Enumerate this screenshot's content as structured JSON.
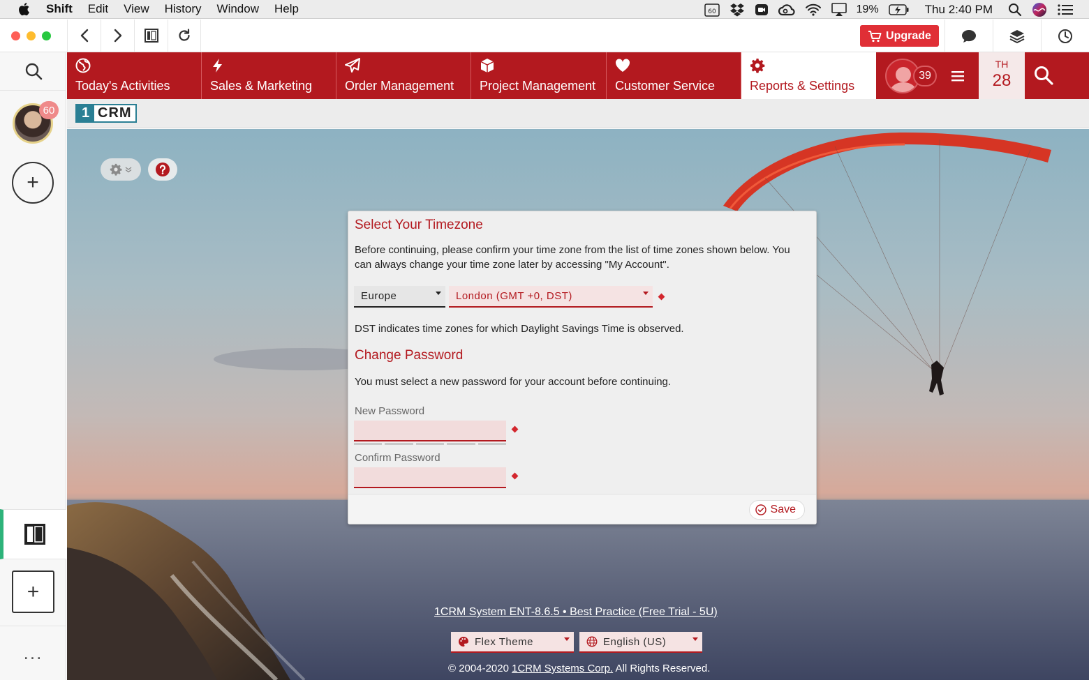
{
  "menubar": {
    "app_name": "Shift",
    "items": [
      "Edit",
      "View",
      "History",
      "Window",
      "Help"
    ],
    "battery": "19%",
    "clock": "Thu 2:40 PM",
    "icons": [
      "apple-logo",
      "cal60-icon",
      "dropbox-icon",
      "camera-icon",
      "creative-cloud-icon",
      "wifi-icon",
      "airplay-icon",
      "battery-icon",
      "spotlight-icon",
      "siri-icon",
      "notification-list-icon"
    ]
  },
  "toolbar": {
    "upgrade_label": "Upgrade",
    "icons": [
      "back-icon",
      "forward-icon",
      "app-icon",
      "reload-icon",
      "chat-icon",
      "layers-icon",
      "clock-icon"
    ]
  },
  "dock": {
    "avatar_badge": "60",
    "more": "..."
  },
  "nav": {
    "tabs": [
      {
        "label": "Today's Activities",
        "icon": "globe-icon"
      },
      {
        "label": "Sales & Marketing",
        "icon": "bolt-icon"
      },
      {
        "label": "Order Management",
        "icon": "paper-plane-icon"
      },
      {
        "label": "Project Management",
        "icon": "cube-icon"
      },
      {
        "label": "Customer Service",
        "icon": "heart-icon"
      },
      {
        "label": "Reports & Settings",
        "icon": "gear-icon"
      }
    ],
    "notification_count": "39",
    "date_dow": "TH",
    "date_day": "28",
    "brand_color": "#b3191f"
  },
  "logo": {
    "number": "1",
    "text": "CRM"
  },
  "dialog": {
    "title": "Select Your Timezone",
    "intro": "Before continuing, please confirm your time zone from the list of time zones shown below. You can always change your time zone later by accessing \"My Account\".",
    "region_value": "Europe",
    "city_value": "London (GMT +0, DST)",
    "dst_note": "DST indicates time zones for which Daylight Savings Time is observed.",
    "password_title": "Change Password",
    "password_intro": "You must select a new password for your account before continuing.",
    "new_password_label": "New Password",
    "confirm_password_label": "Confirm Password",
    "new_password_value": "",
    "confirm_password_value": "",
    "save_label": "Save"
  },
  "footer": {
    "system_link": "1CRM System ENT-8.6.5 • Best Practice (Free Trial - 5U)",
    "theme_value": "Flex Theme",
    "language_value": "English (US)",
    "copyright_prefix": "© 2004-2020",
    "copyright_link": "1CRM Systems Corp.",
    "copyright_suffix": "All Rights Reserved."
  }
}
